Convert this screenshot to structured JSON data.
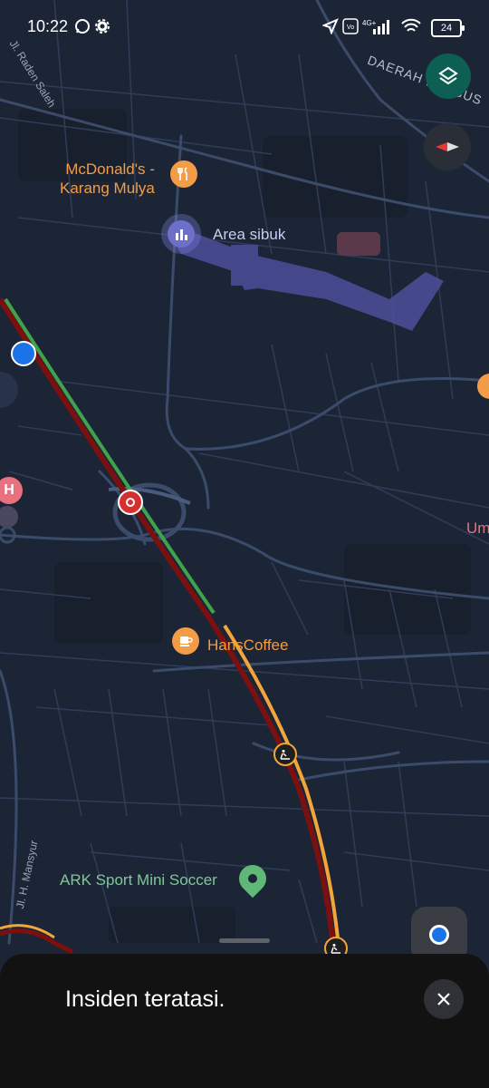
{
  "status_bar": {
    "time": "10:22",
    "battery": "24"
  },
  "map": {
    "places": {
      "mcdonalds": "McDonald's -\nKarang Mulya",
      "busy_area": "Area sibuk",
      "hans_coffee": "HansCoffee",
      "ark_sport": "ARK Sport Mini Soccer",
      "umh": "Um"
    },
    "streets": {
      "raden_saleh": "Jl. Raden Saleh",
      "mansyur": "Jl. H. Mansyur",
      "daerah": "DAERAH KHUSUS"
    },
    "colors": {
      "traffic_heavy": "#8e1b1b",
      "traffic_free": "#3fa34d",
      "traffic_slow": "#f2a53a",
      "busy_area": "#5c5fb8",
      "food_icon": "#f29c47",
      "hospital": "#e8707f",
      "location_dot": "#1a73e8"
    }
  },
  "bottom_sheet": {
    "message": "Insiden teratasi."
  }
}
